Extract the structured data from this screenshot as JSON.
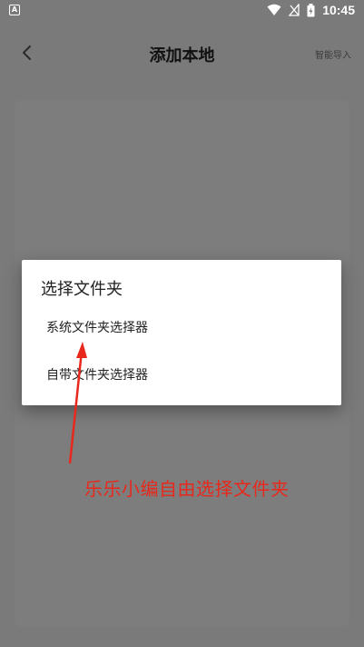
{
  "status_bar": {
    "left_icon_letter": "A",
    "time": "10:45",
    "icons": [
      "wifi-icon",
      "no-signal-icon",
      "battery-charging-icon"
    ]
  },
  "header": {
    "title": "添加本地",
    "back_icon": "chevron-left-icon",
    "smart_import_label": "智能导入"
  },
  "dialog": {
    "title": "选择文件夹",
    "options": [
      {
        "label": "系统文件夹选择器"
      },
      {
        "label": "自带文件夹选择器"
      }
    ]
  },
  "annotation": {
    "text": "乐乐小编自由选择文件夹",
    "color": "#e8281c"
  },
  "colors": {
    "overlay_background": "#7a7a7a",
    "dialog_background": "#ffffff"
  }
}
